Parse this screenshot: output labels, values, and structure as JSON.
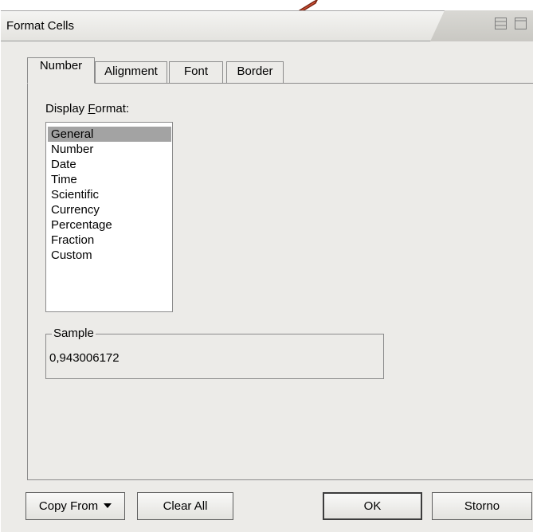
{
  "window": {
    "title": "Format Cells"
  },
  "tabs": [
    {
      "label": "Number"
    },
    {
      "label": "Alignment"
    },
    {
      "label": "Font"
    },
    {
      "label": "Border"
    }
  ],
  "number_tab": {
    "display_format_label": "Display Format:",
    "display_format_accel": "F",
    "formats": [
      "General",
      "Number",
      "Date",
      "Time",
      "Scientific",
      "Currency",
      "Percentage",
      "Fraction",
      "Custom"
    ],
    "selected_format": "General",
    "sample_title": "Sample",
    "sample_value": "0,943006172"
  },
  "buttons": {
    "copy_from": "Copy From",
    "clear_all": "Clear All",
    "ok": "OK",
    "cancel": "Storno"
  },
  "icons": {
    "titlebar_left": "restore-icon",
    "titlebar_right": "maximize-icon",
    "pointer": "arrow-pointer-icon"
  },
  "colors": {
    "dialog_bg": "#ecebe8",
    "selection_bg": "#a3a3a3",
    "arrow": "#d9543a"
  }
}
